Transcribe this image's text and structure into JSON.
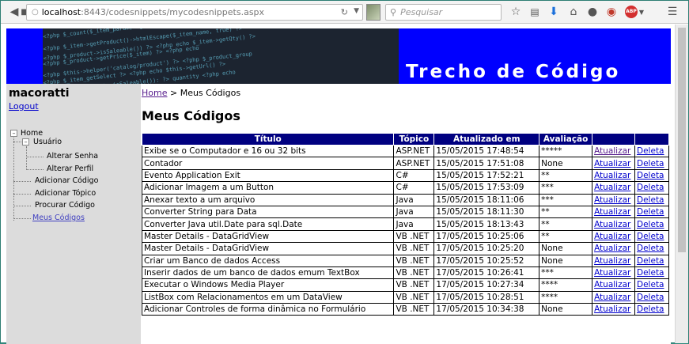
{
  "browser": {
    "url_host": "localhost",
    "url_path": ":8443/codesnippets/mycodesnippets.aspx",
    "search_placeholder": "Pesquisar",
    "ext_badge": "ABP"
  },
  "banner": {
    "title": "Trecho de Código",
    "code_lines": [
      "<?php $_count($_item_param)->getName ?>",
      "<?php $_item->getProduct()->htmlEscape($_item_name, true) ?>",
      "<?php $_product->isSaleable()) ?> <?php echo $_item->getQty() ?>",
      "<?php $_product->getPrice($_item) ?> <?php echo",
      "<?php $this->helper('catalog/product') ?> <?php $_product_group",
      "<?php $_item_getSelect ?> <?php echo $this->getUrl() ?>",
      "<?php if ($_product->isSaleable()): ?> quantity <?php echo"
    ]
  },
  "sidebar": {
    "user": "macoratti",
    "logout": "Logout",
    "tree": {
      "home": "Home",
      "usuario": "Usuário",
      "alterar_senha": "Alterar Senha",
      "alterar_perfil": "Alterar Perfil",
      "adicionar_codigo": "Adicionar Código",
      "adicionar_topico": "Adicionar Tópico",
      "procurar_codigo": "Procurar Código",
      "meus_codigos": "Meus Códigos"
    }
  },
  "content": {
    "breadcrumb_home": "Home",
    "breadcrumb_sep": " > ",
    "breadcrumb_current": "Meus Códigos",
    "heading": "Meus Códigos",
    "table": {
      "headers": [
        "Título",
        "Tópico",
        "Atualizado em",
        "Avaliação",
        "",
        ""
      ],
      "update_label": "Atualizar",
      "delete_label": "Deleta",
      "rows": [
        [
          "Exibe se o Computador e 16 ou 32 bits",
          "ASP.NET",
          "15/05/2015 17:48:54",
          "*****"
        ],
        [
          "Contador",
          "ASP.NET",
          "15/05/2015 17:51:08",
          "None"
        ],
        [
          "Evento Application Exit",
          "C#",
          "15/05/2015 17:52:21",
          "**"
        ],
        [
          "Adicionar Imagem a um Button",
          "C#",
          "15/05/2015 17:53:09",
          "***"
        ],
        [
          "Anexar texto a um arquivo",
          "Java",
          "15/05/2015 18:11:06",
          "***"
        ],
        [
          "Converter String para Data",
          "Java",
          "15/05/2015 18:11:30",
          "**"
        ],
        [
          "Converter Java util.Date para sql.Date",
          "Java",
          "15/05/2015 18:13:43",
          "**"
        ],
        [
          "Master Details - DataGridView",
          "VB .NET",
          "17/05/2015 10:25:06",
          "**"
        ],
        [
          "Master Details - DataGridView",
          "VB .NET",
          "17/05/2015 10:25:20",
          "None"
        ],
        [
          "Criar um Banco de dados Access",
          "VB .NET",
          "17/05/2015 10:25:52",
          "None"
        ],
        [
          "Inserir dados de um banco de dados emum TextBox",
          "VB .NET",
          "17/05/2015 10:26:41",
          "***"
        ],
        [
          "Executar o Windows Media Player",
          "VB .NET",
          "17/05/2015 10:27:34",
          "****"
        ],
        [
          "ListBox com Relacionamentos em um DataView",
          "VB .NET",
          "17/05/2015 10:28:51",
          "****"
        ],
        [
          "Adicionar Controles de forma dinâmica no Formulário",
          "VB .NET",
          "17/05/2015 10:34:38",
          "None"
        ]
      ]
    }
  },
  "colors": {
    "banner": "#0000ff",
    "table_header": "#000080",
    "sidebar": "#dcdcdc"
  }
}
